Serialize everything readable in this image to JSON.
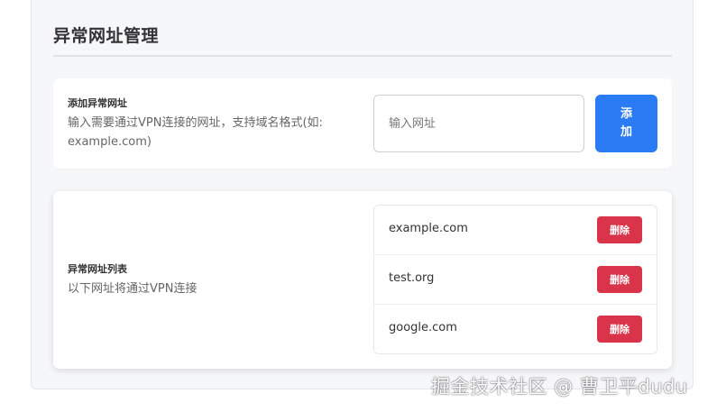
{
  "page": {
    "title": "异常网址管理"
  },
  "add_section": {
    "heading": "添加异常网址",
    "description_line1": "输入需要通过VPN连接的网址，支持域名格式(如:",
    "description_line2": "example.com)",
    "input_value": "",
    "input_placeholder": "输入网址",
    "add_label_line1": "添",
    "add_label_line2": "加"
  },
  "list_section": {
    "heading": "异常网址列表",
    "description": "以下网址将通过VPN连接",
    "delete_label": "删除",
    "urls": [
      {
        "url": "example.com"
      },
      {
        "url": "test.org"
      },
      {
        "url": "google.com"
      }
    ]
  },
  "watermark": "掘金技术社区 @ 曹卫平dudu",
  "colors": {
    "primary": "#2b7cf4",
    "danger": "#d9344a",
    "panel_bg": "#f6f7f9"
  }
}
